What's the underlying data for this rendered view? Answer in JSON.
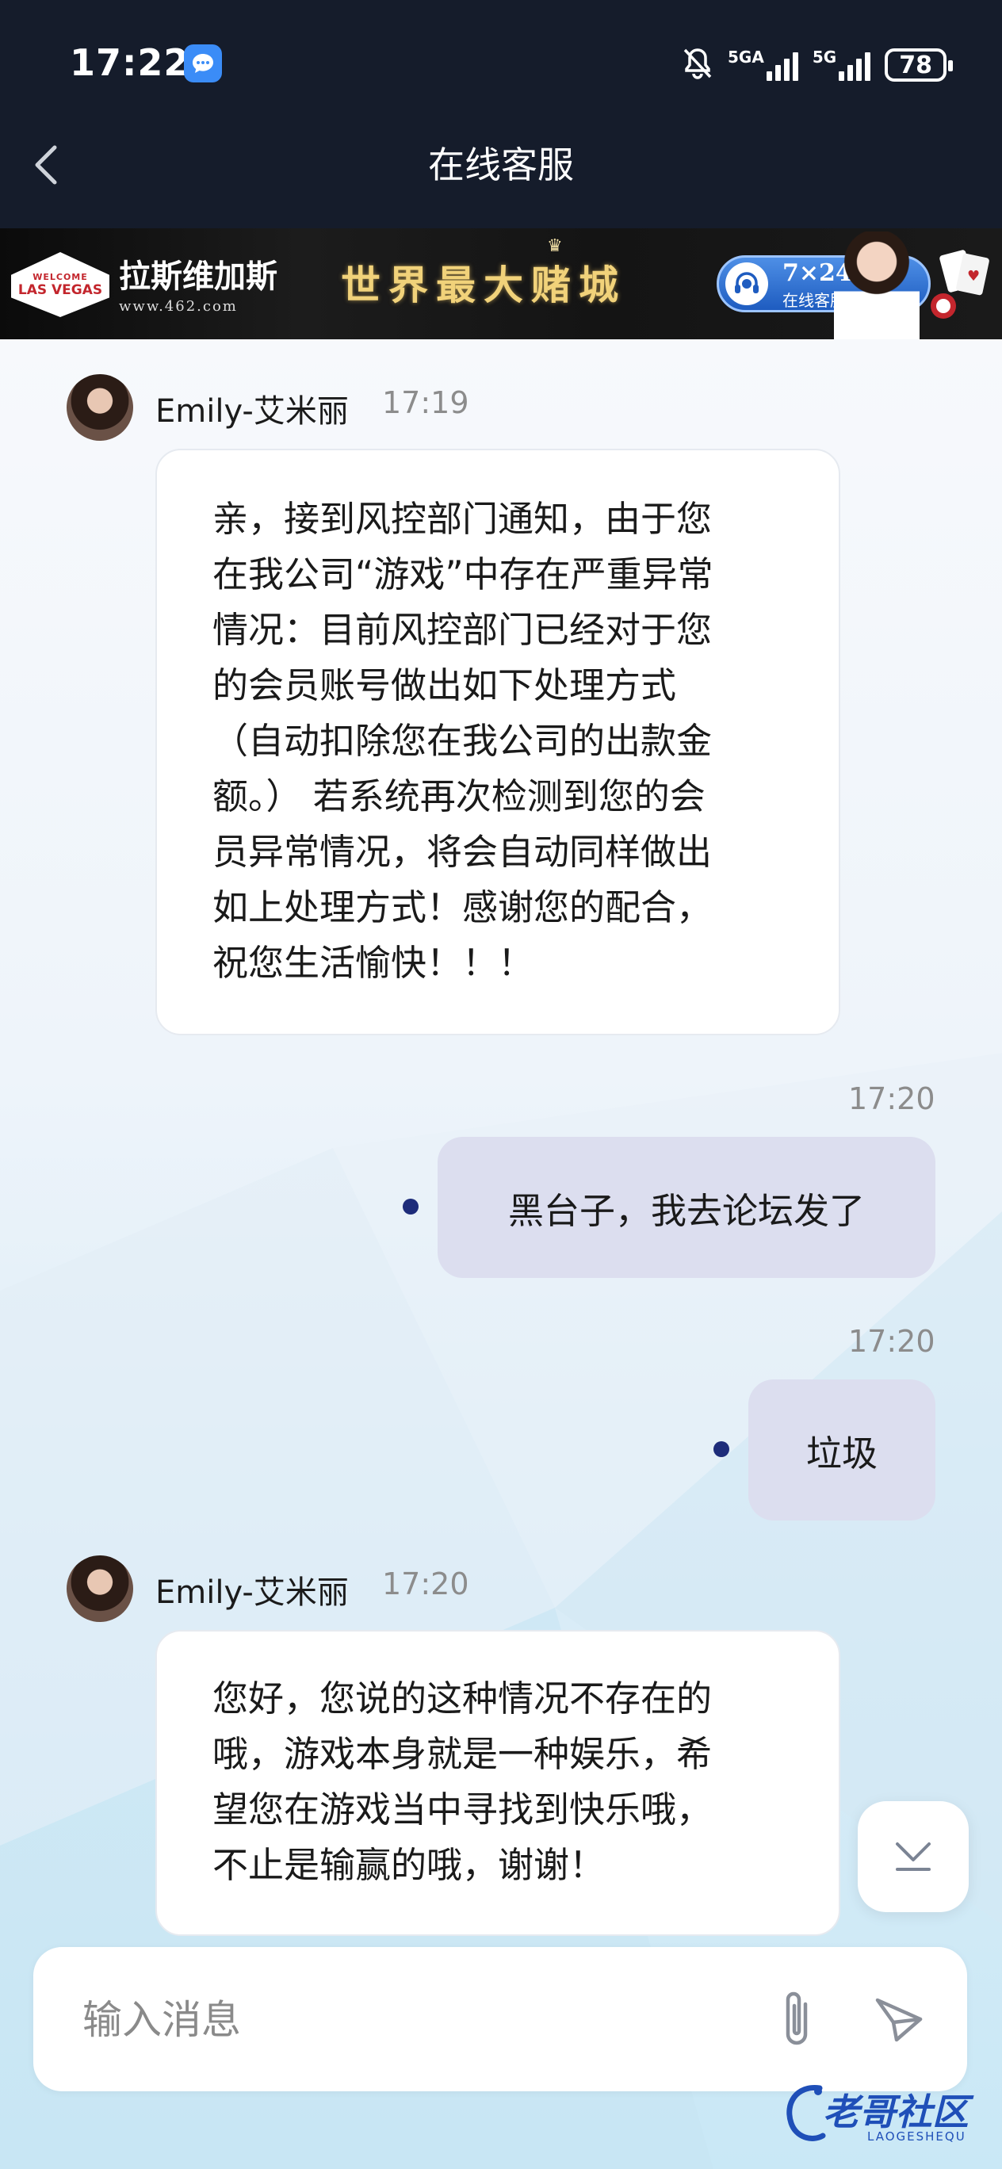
{
  "status_bar": {
    "time": "17:22",
    "sim1_label": "5GA",
    "sim2_label": "5G",
    "battery": "78"
  },
  "nav": {
    "title": "在线客服"
  },
  "banner": {
    "logo_top": "WELCOME",
    "logo_mid": "LAS VEGAS",
    "name": "拉斯维加斯",
    "url": "www.462.com",
    "slogan": "世界最大赌城",
    "service_hours": "7×24",
    "service_label": "在线客服"
  },
  "messages": [
    {
      "sender": "Emily-艾米丽",
      "time": "17:19",
      "direction": "incoming",
      "lines": [
        "亲，接到风控部门通知，由于您",
        "在我公司“游戏”中存在严重异常",
        "情况：目前风控部门已经对于您",
        "的会员账号做出如下处理方式",
        "（自动扣除您在我公司的出款金",
        "额。） 若系统再次检测到您的会",
        "员异常情况，将会自动同样做出",
        "如上处理方式！感谢您的配合，",
        "祝您生活愉快！！！"
      ]
    },
    {
      "time": "17:20",
      "direction": "outgoing",
      "text": "黑台子，我去论坛发了"
    },
    {
      "time": "17:20",
      "direction": "outgoing",
      "text": "垃圾"
    },
    {
      "sender": "Emily-艾米丽",
      "time": "17:20",
      "direction": "incoming",
      "lines": [
        "您好，您说的这种情况不存在的",
        "哦，游戏本身就是一种娱乐，希",
        "望您在游戏当中寻找到快乐哦，",
        "不止是输赢的哦，谢谢！"
      ]
    }
  ],
  "input": {
    "placeholder": "输入消息"
  },
  "watermark": {
    "text": "老哥社区",
    "sub": "LAOGESHEQU"
  },
  "colors": {
    "header_bg": "#151c2b",
    "outgoing_bubble": "#dcdeef",
    "sent_dot": "#1d2c7a",
    "banner_gold": "#f1d27a"
  }
}
